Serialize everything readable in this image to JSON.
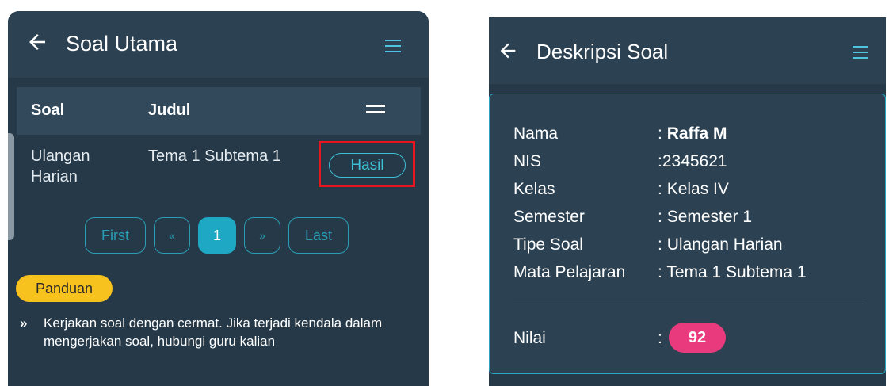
{
  "left_screen": {
    "header": {
      "title": "Soal Utama",
      "back_icon": "arrow-left-icon",
      "menu_icon": "menu-icon"
    },
    "table": {
      "columns": [
        "Soal",
        "Judul"
      ],
      "menu_icon": "equals-icon",
      "rows": [
        {
          "soal": "Ulangan Harian",
          "judul": "Tema 1 Subtema 1",
          "action": "Hasil"
        }
      ]
    },
    "pagination": {
      "first": "First",
      "prev": "«",
      "current": "1",
      "next": "»",
      "last": "Last"
    },
    "guide": {
      "badge": "Panduan",
      "text": "Kerjakan soal dengan cermat. Jika terjadi kendala dalam mengerjakan soal, hubungi guru kalian"
    },
    "colors": {
      "highlight": "#e8141e",
      "accent": "#3fbfd6",
      "badge": "#f7c21e"
    }
  },
  "right_screen": {
    "header": {
      "title": "Deskripsi Soal",
      "back_icon": "arrow-left-icon",
      "menu_icon": "menu-icon"
    },
    "details": [
      {
        "label": "Nama",
        "value": "Raffa M"
      },
      {
        "label": "NIS",
        "value": "2345621"
      },
      {
        "label": "Kelas",
        "value": "Kelas IV"
      },
      {
        "label": "Semester",
        "value": "Semester 1"
      },
      {
        "label": "Tipe Soal",
        "value": "Ulangan Harian"
      },
      {
        "label": "Mata Pelajaran",
        "value": "Tema 1 Subtema 1"
      }
    ],
    "separator": ":",
    "score": {
      "label": "Nilai",
      "value": "92"
    },
    "colors": {
      "score_badge": "#e83a7c",
      "card_border": "#2aa6c2"
    }
  }
}
